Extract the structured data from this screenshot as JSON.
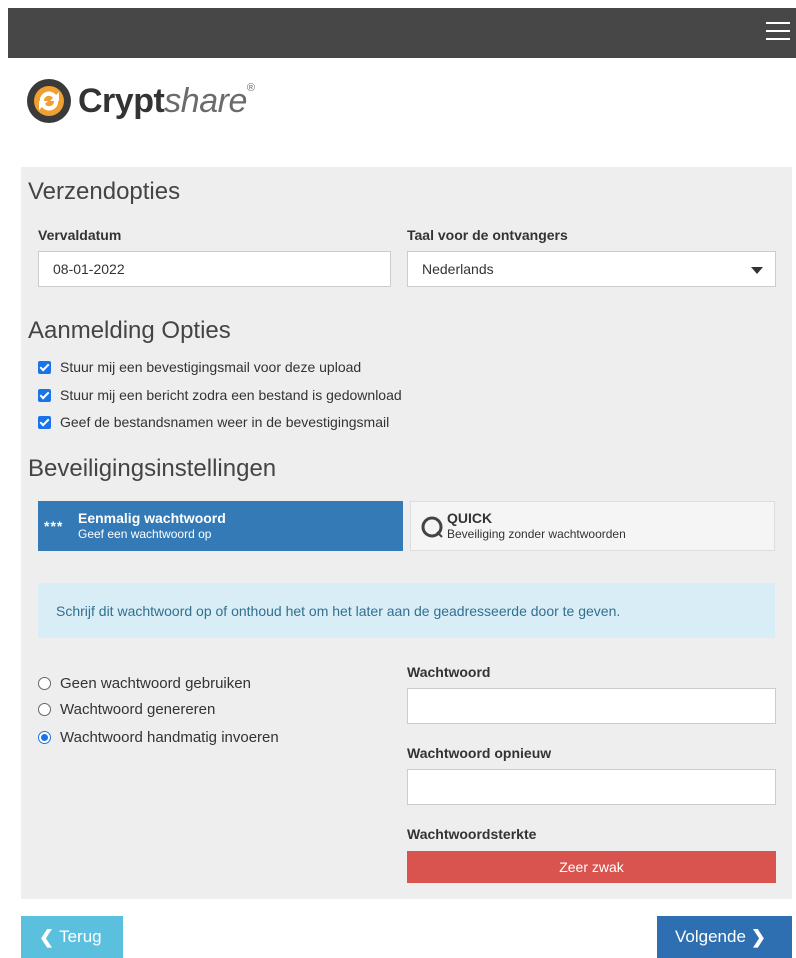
{
  "header": {
    "menu_icon": "hamburger-menu-icon"
  },
  "brand": {
    "name_bold": "Crypt",
    "name_light": "share",
    "registered": "®",
    "logo_icon": "cryptshare-logo-icon"
  },
  "send_options": {
    "heading": "Verzendopties",
    "expiry_label": "Vervaldatum",
    "expiry_value": "08-01-2022",
    "language_label": "Taal voor de ontvangers",
    "language_value": "Nederlands"
  },
  "notification_options": {
    "heading": "Aanmelding Opties",
    "items": [
      {
        "label": "Stuur mij een bevestigingsmail voor deze upload",
        "checked": true
      },
      {
        "label": "Stuur mij een bericht zodra een bestand is gedownload",
        "checked": true
      },
      {
        "label": "Geef de bestandsnamen weer in de bevestigingsmail",
        "checked": true
      }
    ]
  },
  "security": {
    "heading": "Beveiligingsinstellingen",
    "modes": [
      {
        "icon": "***",
        "title": "Eenmalig wachtwoord",
        "subtitle": "Geef een wachtwoord op",
        "selected": true
      },
      {
        "icon": "quick-icon",
        "title": "QUICK",
        "subtitle": "Beveiliging zonder wachtwoorden",
        "selected": false
      }
    ],
    "info_text": "Schrijf dit wachtwoord op of onthoud het om het later aan de geadresseerde door te geven.",
    "password_options": [
      {
        "label": "Geen wachtwoord gebruiken",
        "checked": false
      },
      {
        "label": "Wachtwoord genereren",
        "checked": false
      },
      {
        "label": "Wachtwoord handmatig invoeren",
        "checked": true
      }
    ],
    "password_label": "Wachtwoord",
    "password_value": "",
    "password_repeat_label": "Wachtwoord opnieuw",
    "password_repeat_value": "",
    "strength_label": "Wachtwoordsterkte",
    "strength_value": "Zeer zwak",
    "strength_color": "#d9534f"
  },
  "footer": {
    "back_label": "Terug",
    "next_label": "Volgende"
  },
  "colors": {
    "accent": "#337ab7",
    "back_button": "#5bc0de",
    "next_button": "#2d6fb0",
    "topbar": "#474747",
    "info_bg": "#d9edf7"
  }
}
